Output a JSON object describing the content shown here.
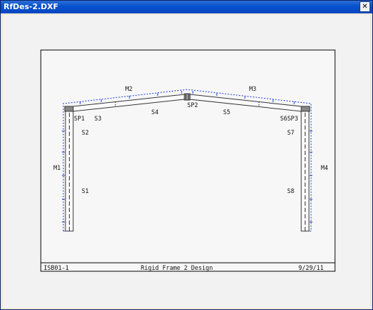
{
  "window": {
    "title": "RfDes-2.DXF",
    "close_glyph": "✕"
  },
  "drawing": {
    "members": [
      "M1",
      "M2",
      "M3",
      "M4"
    ],
    "segments": [
      "S1",
      "S2",
      "S3",
      "S4",
      "S5",
      "S6",
      "S7",
      "S8"
    ],
    "splices": [
      "SP1",
      "SP2",
      "SP3"
    ],
    "labels": {
      "M1": "M1",
      "M2": "M2",
      "M3": "M3",
      "M4": "M4",
      "S1": "S1",
      "S2": "S2",
      "S3": "S3",
      "S4": "S4",
      "S5": "S5",
      "S6SP3": "S6SP3",
      "S7": "S7",
      "S8": "S8",
      "SP1": "SP1",
      "SP2": "SP2"
    },
    "footer": {
      "left": "ISB01-1",
      "center": "Rigid Frame 2 Design",
      "right": "9/29/11"
    }
  }
}
